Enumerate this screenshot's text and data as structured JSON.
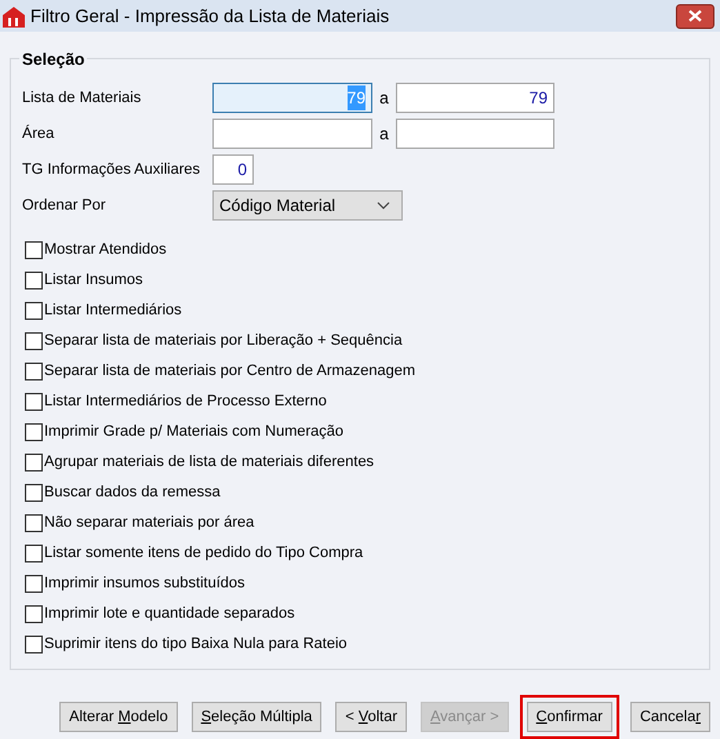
{
  "window": {
    "title": "Filtro Geral - Impressão da Lista de Materiais"
  },
  "group": {
    "title": "Seleção"
  },
  "fields": [
    {
      "kind": "range",
      "label": "Lista de Materiais",
      "from": "79",
      "to": "79",
      "separator": "a",
      "focused": true
    },
    {
      "kind": "range",
      "label": "Área",
      "separator": "a",
      "focused": false
    },
    {
      "kind": "single",
      "label": "TG Informações Auxiliares",
      "value": "0",
      "focused": false
    },
    {
      "kind": "select",
      "label": "Ordenar Por",
      "value": "Código Material",
      "focused": false
    }
  ],
  "checkboxes": [
    {
      "label": "Mostrar Atendidos",
      "checked": false
    },
    {
      "label": "Listar Insumos",
      "checked": false
    },
    {
      "label": "Listar Intermediários",
      "checked": false
    },
    {
      "label": "Separar lista de materiais por Liberação + Sequência",
      "checked": false
    },
    {
      "label": "Separar lista de materiais por Centro de Armazenagem",
      "checked": false
    },
    {
      "label": "Listar Intermediários de Processo Externo",
      "checked": false
    },
    {
      "label": "Imprimir Grade p/ Materiais com Numeração",
      "checked": false
    },
    {
      "label": "Agrupar materiais de lista de materiais diferentes",
      "checked": false
    },
    {
      "label": "Buscar dados da remessa",
      "checked": false
    },
    {
      "label": "Não separar materiais por área",
      "checked": false
    },
    {
      "label": "Listar somente itens de pedido do Tipo Compra",
      "checked": false
    },
    {
      "label": "Imprimir insumos substituídos",
      "checked": false
    },
    {
      "label": "Imprimir lote e quantidade separados",
      "checked": false
    },
    {
      "label": "Suprimir itens do tipo Baixa Nula para Rateio",
      "checked": false
    }
  ],
  "buttons": [
    {
      "pre": "Alterar ",
      "key": "M",
      "post": "odelo",
      "disabled": false,
      "highlighted": false
    },
    {
      "key": "S",
      "post": "eleção Múltipla",
      "disabled": false,
      "highlighted": false
    },
    {
      "pre": "< ",
      "key": "V",
      "post": "oltar",
      "disabled": false,
      "highlighted": false
    },
    {
      "key": "A",
      "post": "vançar >",
      "disabled": true,
      "highlighted": false
    },
    {
      "key": "C",
      "post": "onfirmar",
      "disabled": false,
      "highlighted": true
    },
    {
      "pre": "Cancela",
      "key": "r",
      "disabled": false,
      "highlighted": false
    }
  ]
}
